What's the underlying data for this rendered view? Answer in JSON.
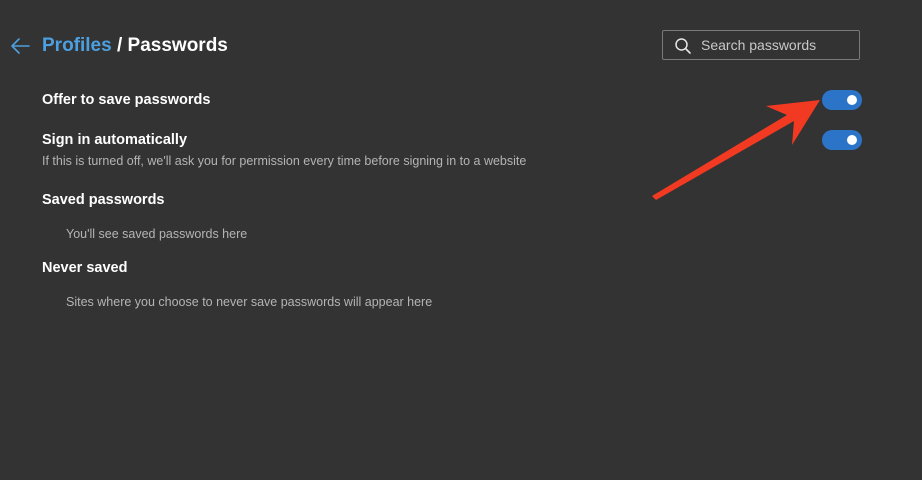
{
  "header": {
    "back_icon": "arrow-left-icon",
    "breadcrumb_parent": "Profiles",
    "breadcrumb_separator": "/",
    "breadcrumb_current": "Passwords"
  },
  "search": {
    "icon": "search-icon",
    "placeholder": "Search passwords",
    "value": ""
  },
  "settings": {
    "offer_to_save": {
      "label": "Offer to save passwords",
      "enabled": true
    },
    "sign_in_automatically": {
      "label": "Sign in automatically",
      "description": "If this is turned off, we'll ask you for permission every time before signing in to a website",
      "enabled": true
    }
  },
  "saved_passwords": {
    "title": "Saved passwords",
    "empty_text": "You'll see saved passwords here"
  },
  "never_saved": {
    "title": "Never saved",
    "empty_text": "Sites where you choose to never save passwords will appear here"
  },
  "colors": {
    "background": "#333333",
    "accent": "#4ca0e0",
    "toggle_on": "#2c74c8",
    "annotation_arrow": "#f23a22"
  }
}
